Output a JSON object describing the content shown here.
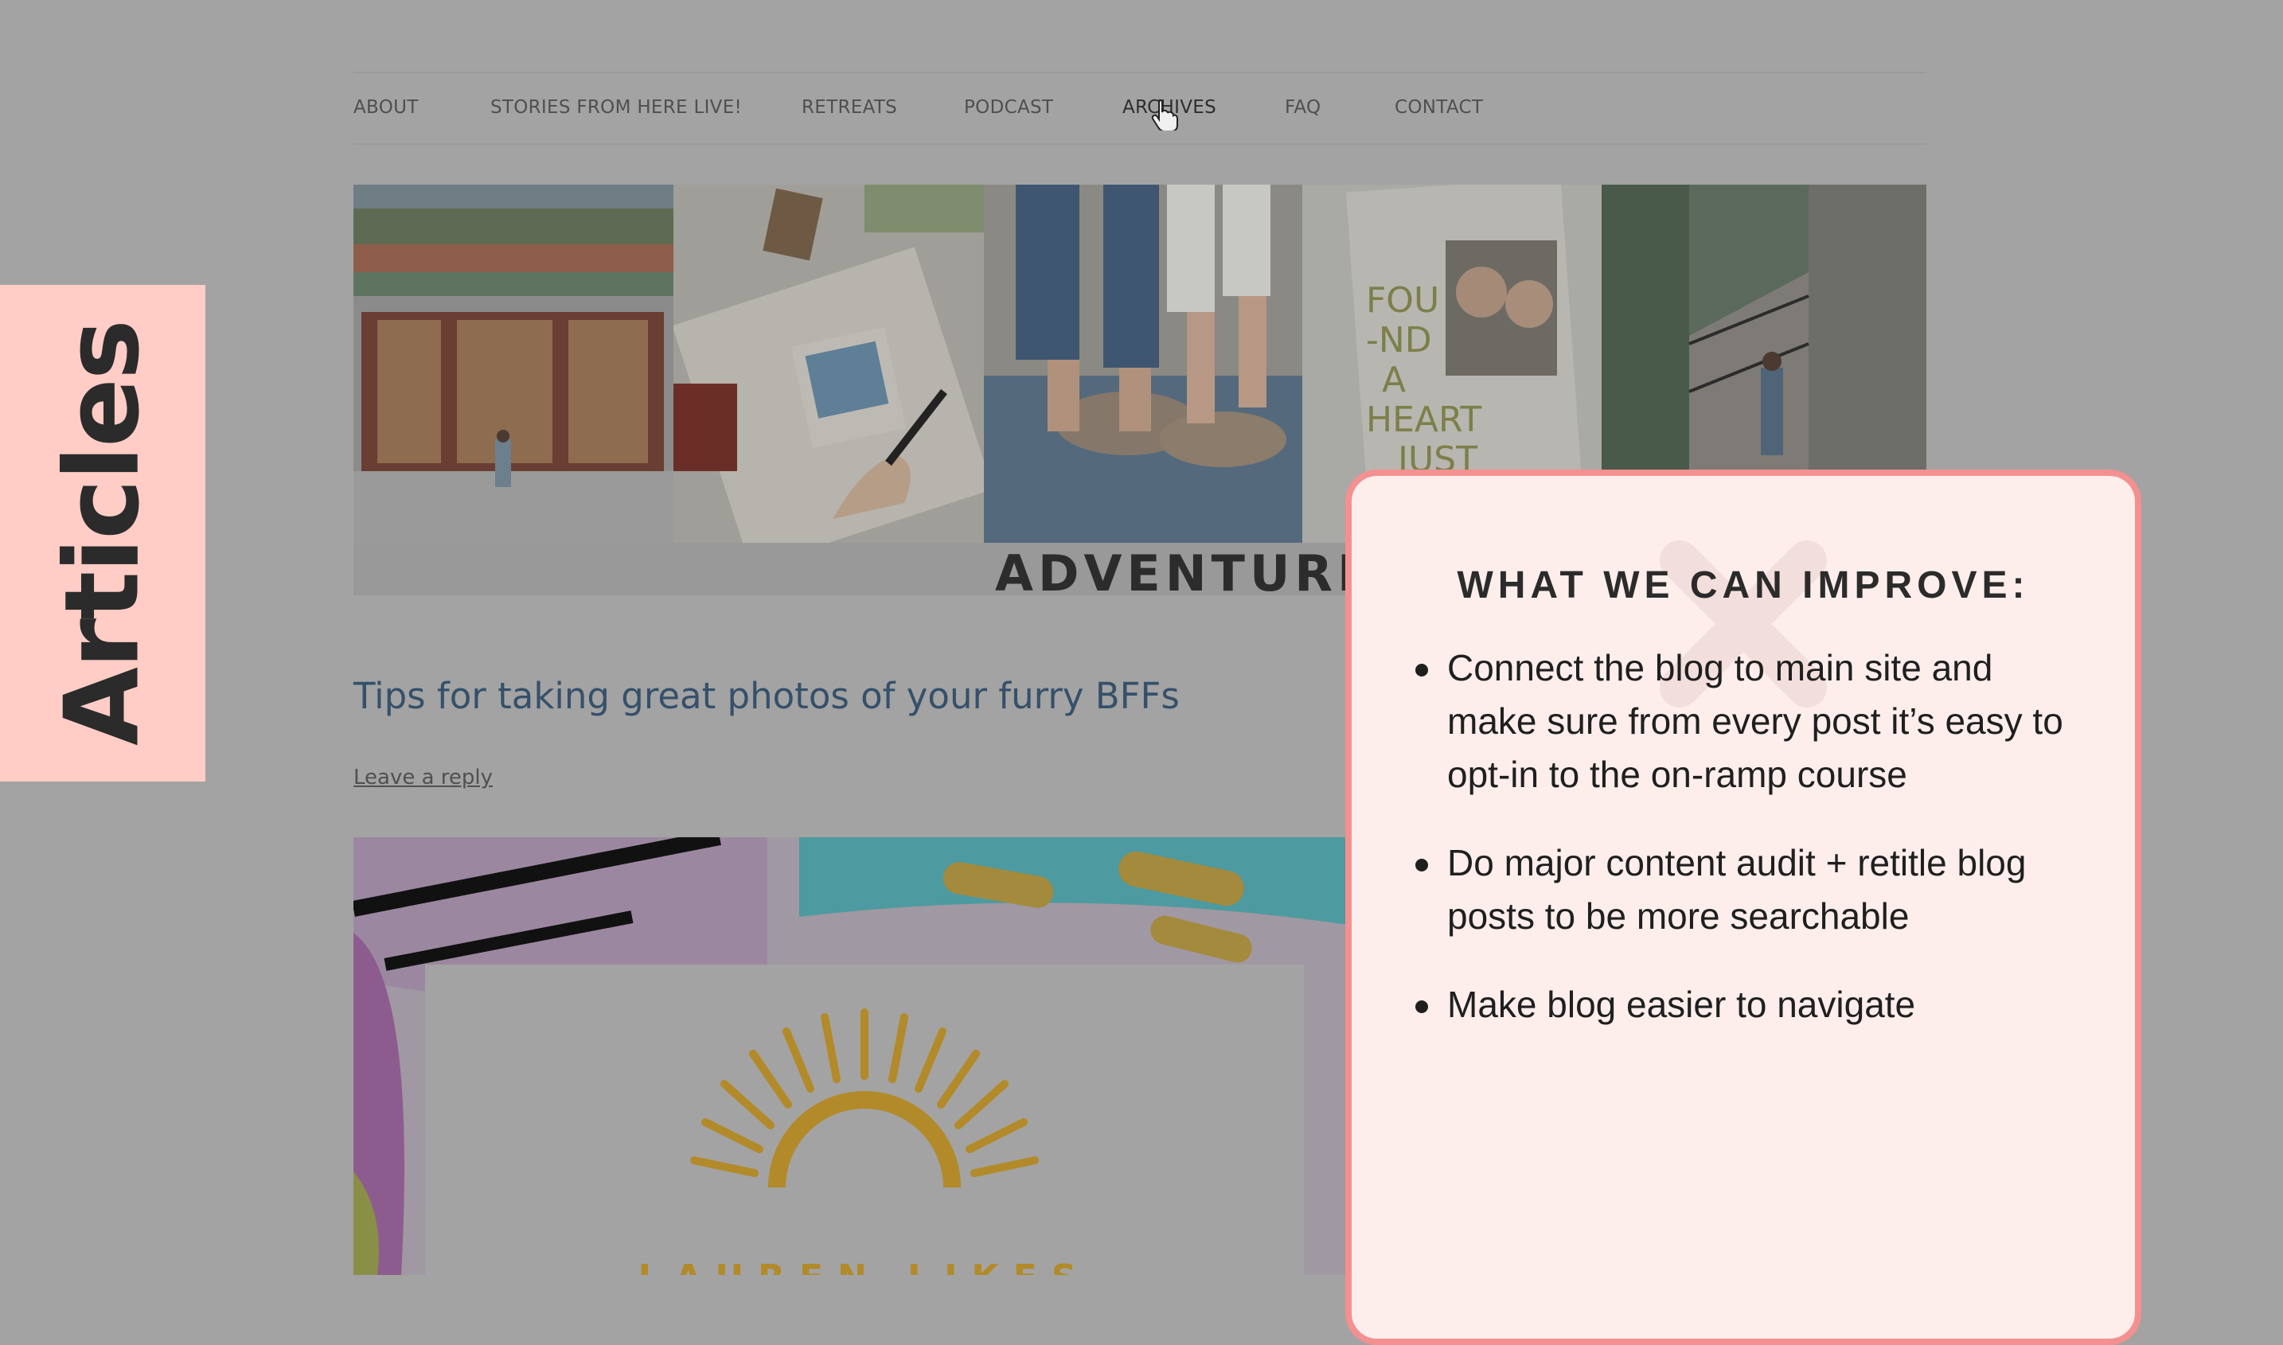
{
  "nav": {
    "items": [
      {
        "label": "ABOUT"
      },
      {
        "label": "STORIES FROM HERE LIVE!"
      },
      {
        "label": "RETREATS"
      },
      {
        "label": "PODCAST"
      },
      {
        "label": "ARCHIVES"
      },
      {
        "label": "FAQ"
      },
      {
        "label": "CONTACT"
      }
    ],
    "active": "ARCHIVES"
  },
  "banner": {
    "tagline": "ADVENTURE. CR",
    "collage_text": "I FOU-ND A HEART JUST LIKE"
  },
  "post": {
    "title": "Tips for taking great photos of your furry BFFs",
    "reply_link": "Leave a reply",
    "image_logo_text": "LAUREN LIKES"
  },
  "side_tab": {
    "label": "Articles",
    "color": "#ffcdc5"
  },
  "panel": {
    "heading": "WHAT WE CAN IMPROVE:",
    "bullets": [
      "Connect the blog to main site and make sure from every post it’s easy to opt-in to the on-ramp course",
      "Do major content audit + retitle blog posts to be more searchable",
      "Make blog easier to navigate"
    ],
    "border_color": "#f49090",
    "background_color": "#fdeeec"
  },
  "icons": {
    "cursor": "hand-pointer-icon",
    "panel_mark": "x-mark-icon"
  }
}
